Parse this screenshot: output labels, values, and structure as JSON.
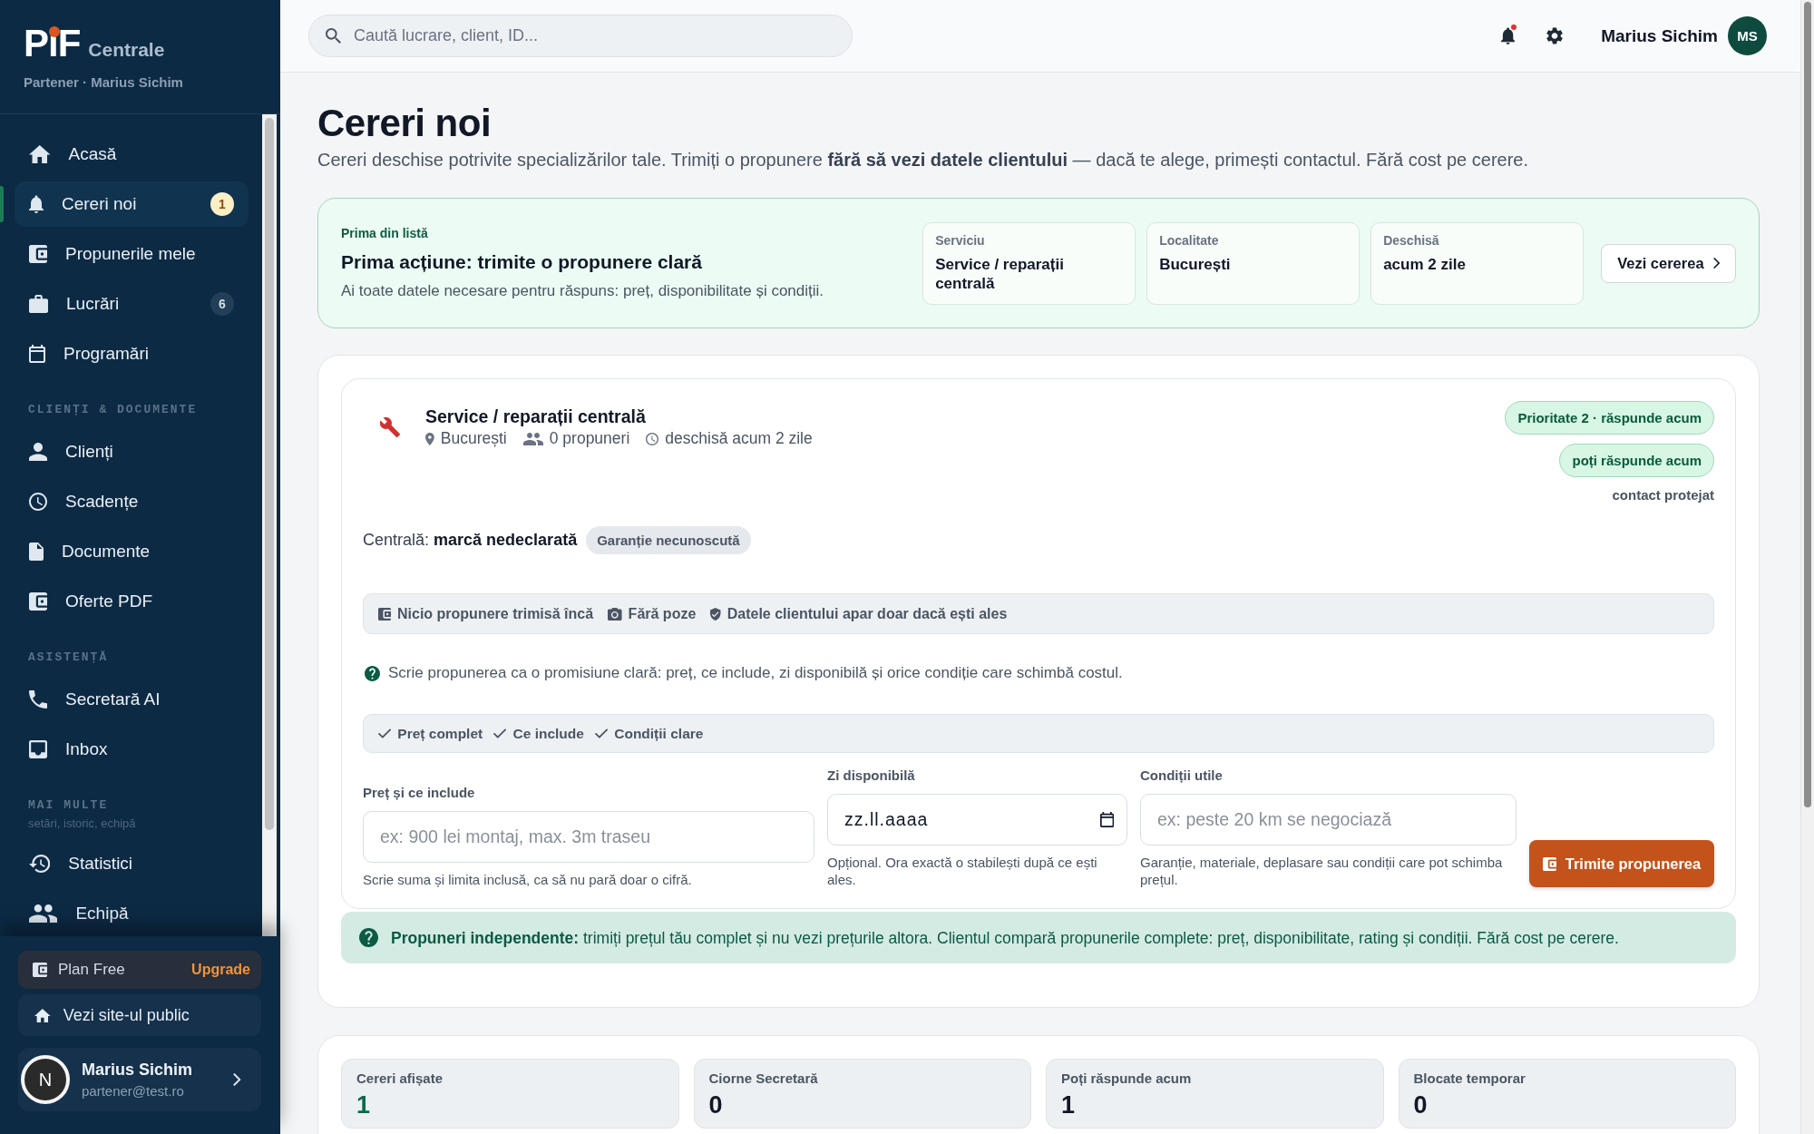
{
  "sidebar": {
    "brand": {
      "logo": "PiF",
      "product": "Centrale"
    },
    "account_line": "Partener · Marius Sichim",
    "nav": [
      {
        "items": [
          {
            "label": "Acasă",
            "selected": false
          },
          {
            "label": "Cereri noi",
            "selected": true,
            "badge": {
              "text": "1",
              "highlighted": true
            }
          },
          {
            "label": "Propunerile mele",
            "selected": false
          },
          {
            "label": "Lucrări",
            "selected": false,
            "badge": {
              "text": "6",
              "highlighted": false
            }
          },
          {
            "label": "Programări",
            "selected": false
          }
        ]
      },
      {
        "heading": "CLIENȚI & DOCUMENTE",
        "items": [
          {
            "label": "Clienți",
            "selected": false
          },
          {
            "label": "Scadențe",
            "selected": false
          },
          {
            "label": "Documente",
            "selected": false
          },
          {
            "label": "Oferte PDF",
            "selected": false
          }
        ]
      },
      {
        "heading": "ASISTENȚĂ",
        "items": [
          {
            "label": "Secretară AI",
            "selected": false
          },
          {
            "label": "Inbox",
            "selected": false
          }
        ]
      },
      {
        "heading": "MAI MULTE",
        "caption": "setări, istoric, echipă",
        "items": [
          {
            "label": "Statistici",
            "selected": false
          },
          {
            "label": "Echipă",
            "selected": false
          }
        ]
      }
    ],
    "plan": {
      "label": "Plan Free",
      "action": "Upgrade"
    },
    "public_site_link": "Vezi site-ul public",
    "user": {
      "initial": "N",
      "name": "Marius Sichim",
      "email": "partener@test.ro"
    }
  },
  "topbar": {
    "search": {
      "placeholder": "Caută lucrare, client, ID..."
    },
    "notifications": {
      "unread": true
    },
    "user": {
      "name": "Marius Sichim",
      "initials": "MS"
    }
  },
  "page": {
    "title": "Cereri noi",
    "intro": "Cereri deschise potrivite specializărilor tale. Trimiți o propunere **fără să vezi datele clientului** — dacă te alege, primești contactul. Fără cost pe cerere."
  },
  "featured": {
    "eyebrow": "Prima din listă",
    "title": "Prima acțiune: trimite o propunere clară",
    "text": "Ai toate datele necesare pentru răspuns: preț, disponibilitate și condiții.",
    "facts": [
      {
        "label": "Serviciu",
        "value": "Service / reparații centrală"
      },
      {
        "label": "Localitate",
        "value": "București"
      },
      {
        "label": "Deschisă",
        "value": "acum 2 zile"
      }
    ],
    "button": "Vezi cererea"
  },
  "request": {
    "title": "Service / reparații centrală",
    "meta": [
      "București",
      "0 propuneri",
      "deschisă acum 2 zile"
    ],
    "badges": [
      "Prioritate 2 · răspunde acum",
      "poți răspunde acum"
    ],
    "note": "contact protejat",
    "boiler": "Centrală: **marcă nedeclarată**",
    "warranty_tag": "Garanție necunoscută",
    "status_items": [
      "Nicio propunere trimisă încă",
      "Fără poze",
      "Datele clientului apar doar dacă ești ales"
    ],
    "help": "Scrie propunerea ca o promisiune clară: preț, ce include, zi disponibilă și orice condiție care schimbă costul.",
    "checklist": [
      {
        "label": "Preț complet",
        "checked": true
      },
      {
        "label": "Ce include",
        "checked": true
      },
      {
        "label": "Condiții clare",
        "checked": true
      }
    ],
    "fields": [
      {
        "kind": "text",
        "label": "Preț și ce include",
        "placeholder": "ex: 900 lei montaj, max. 3m traseu",
        "hint": "Scrie suma și limita inclusă, ca să nu pară doar o cifră."
      },
      {
        "kind": "date",
        "label": "Zi disponibilă",
        "placeholder": "zz.ll.aaaa",
        "hint": "Opțional. Ora exactă o stabilești după ce ești ales."
      },
      {
        "kind": "text",
        "label": "Condiții utile",
        "placeholder": "ex: peste 20 km se negociază",
        "hint": "Garanție, materiale, deplasare sau condiții care pot schimba prețul."
      }
    ],
    "submit": "Trimite propunerea"
  },
  "info_banner": "**Propuneri independente:** trimiți prețul tău complet și nu vezi prețurile altora. Clientul compară propunerile complete: preț, disponibilitate, rating și condiții. Fără cost pe cerere.",
  "stats": [
    {
      "label": "Cereri afișate",
      "value": "1",
      "highlighted": true
    },
    {
      "label": "Ciorne Secretară",
      "value": "0",
      "highlighted": false
    },
    {
      "label": "Poți răspunde acum",
      "value": "1",
      "highlighted": false
    },
    {
      "label": "Blocate temporar",
      "value": "0",
      "highlighted": false
    }
  ]
}
